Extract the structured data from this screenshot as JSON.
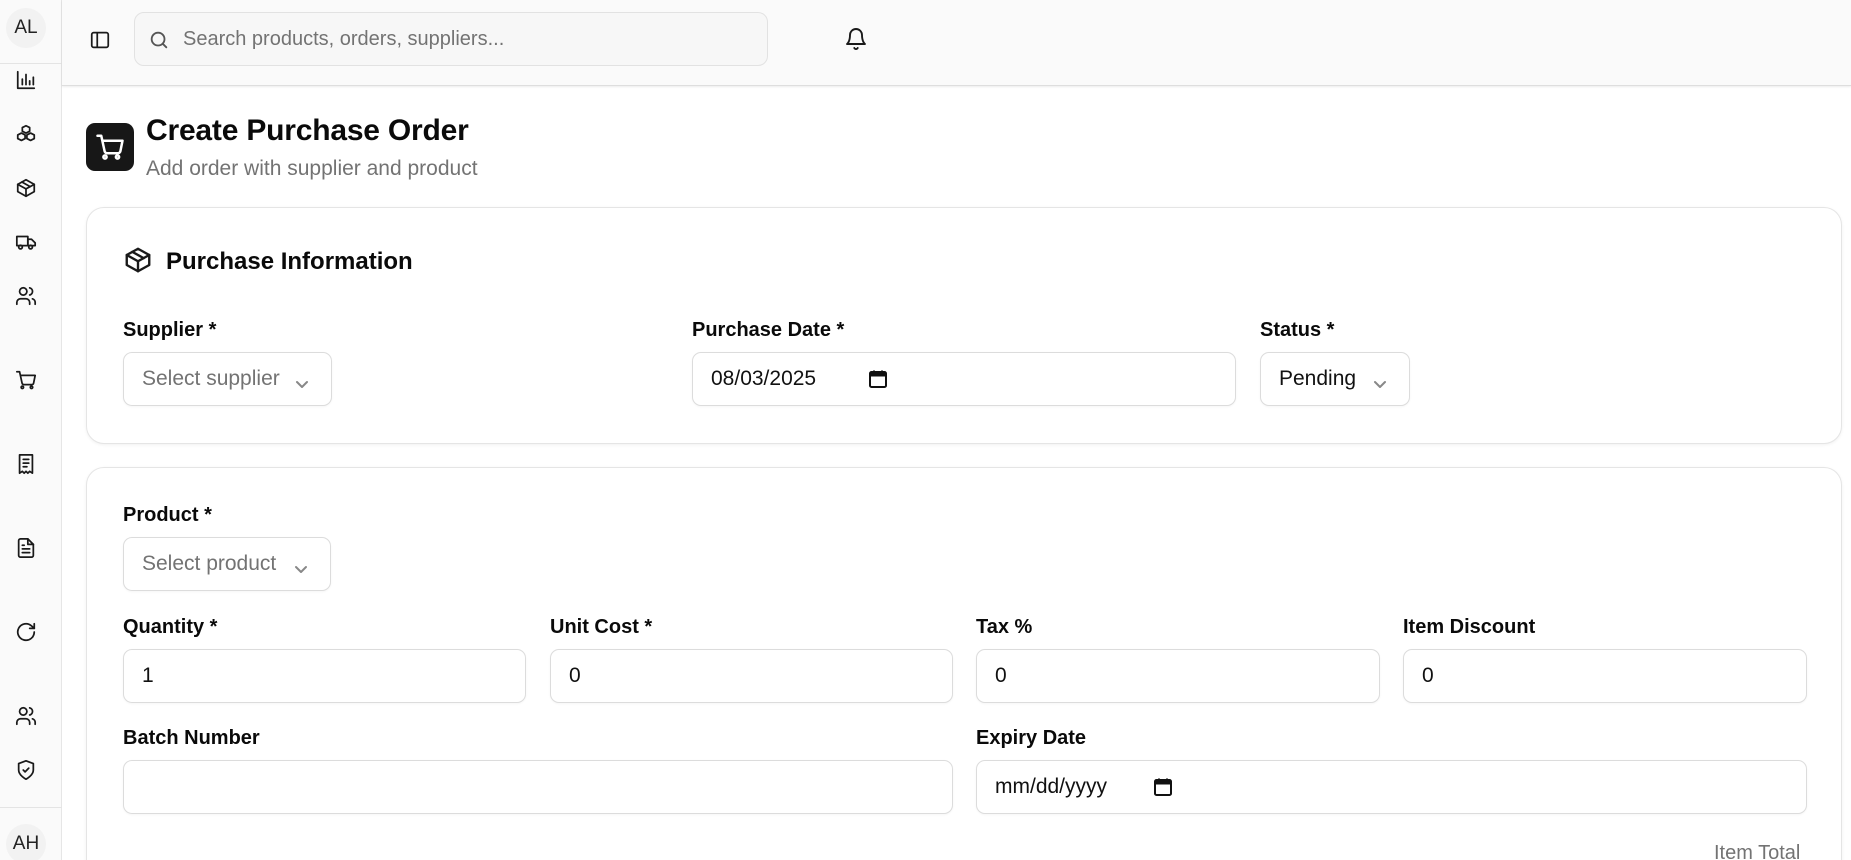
{
  "sidebar": {
    "user_initials": "AL",
    "footer_initials": "AH",
    "items": [
      {
        "icon": "bar-chart-icon"
      },
      {
        "icon": "boxes-icon"
      },
      {
        "icon": "package-icon"
      },
      {
        "icon": "truck-icon"
      },
      {
        "icon": "users-icon"
      },
      {
        "icon": "shopping-cart-icon"
      },
      {
        "icon": "receipt-icon"
      },
      {
        "icon": "file-text-icon"
      },
      {
        "icon": "refresh-icon"
      },
      {
        "icon": "users-icon"
      },
      {
        "icon": "shield-check-icon"
      }
    ]
  },
  "topbar": {
    "search_placeholder": "Search products, orders, suppliers..."
  },
  "header": {
    "title": "Create Purchase Order",
    "subtitle": "Add order with supplier and product"
  },
  "purchase_info": {
    "title": "Purchase Information",
    "supplier_label": "Supplier *",
    "supplier_placeholder": "Select supplier",
    "purchase_date_label": "Purchase Date *",
    "purchase_date_value": "08/03/2025",
    "status_label": "Status *",
    "status_value": "Pending"
  },
  "item": {
    "product_label": "Product *",
    "product_placeholder": "Select product",
    "quantity_label": "Quantity *",
    "quantity_value": "1",
    "unit_cost_label": "Unit Cost *",
    "unit_cost_value": "0",
    "tax_label": "Tax %",
    "tax_value": "0",
    "discount_label": "Item Discount",
    "discount_value": "0",
    "batch_label": "Batch Number",
    "batch_value": "",
    "expiry_label": "Expiry Date",
    "expiry_placeholder": "mm/dd/yyyy",
    "item_total_label": "Item Total"
  }
}
